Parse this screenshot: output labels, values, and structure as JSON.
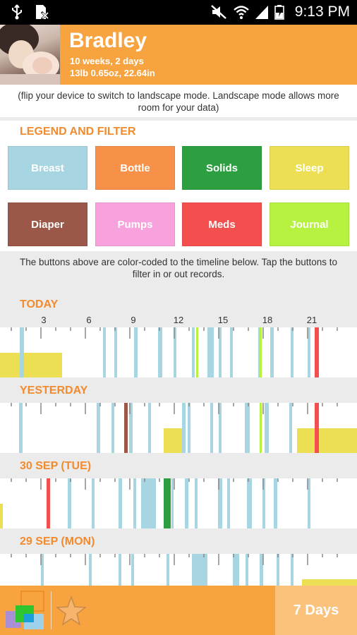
{
  "status_bar": {
    "time": "9:13 PM",
    "icons": [
      "usb-icon",
      "sim-card-icon",
      "mute-icon",
      "wifi-icon",
      "signal-icon",
      "battery-icon"
    ]
  },
  "header": {
    "name": "Bradley",
    "age": "10 weeks, 2 days",
    "measurements": "13lb 0.65oz, 22.64in",
    "photo": "baby-photo"
  },
  "notice": "(flip your device to switch to landscape mode. Landscape mode allows more room for your data)",
  "legend": {
    "title": "LEGEND AND FILTER",
    "buttons": [
      {
        "label": "Breast",
        "color": "#a8d5e2"
      },
      {
        "label": "Bottle",
        "color": "#f79048"
      },
      {
        "label": "Solids",
        "color": "#2ca040"
      },
      {
        "label": "Sleep",
        "color": "#ecdf54"
      },
      {
        "label": "Diaper",
        "color": "#9b5848"
      },
      {
        "label": "Pumps",
        "color": "#f7a2dc"
      },
      {
        "label": "Meds",
        "color": "#f34f4f"
      },
      {
        "label": "Journal",
        "color": "#b6f23f"
      }
    ]
  },
  "hint": "The buttons above are color-coded to the timeline below. Tap the buttons to filter in or out records.",
  "hour_labels": [
    "3",
    "6",
    "9",
    "12",
    "15",
    "18",
    "21"
  ],
  "days": [
    {
      "label": "TODAY"
    },
    {
      "label": "YESTERDAY"
    },
    {
      "label": "30 SEP (TUE)"
    },
    {
      "label": "29 SEP (MON)"
    }
  ],
  "bottom_bar": {
    "range_label": "7 Days",
    "app_icon": "app-logo-icon",
    "star_icon": "star-icon"
  }
}
